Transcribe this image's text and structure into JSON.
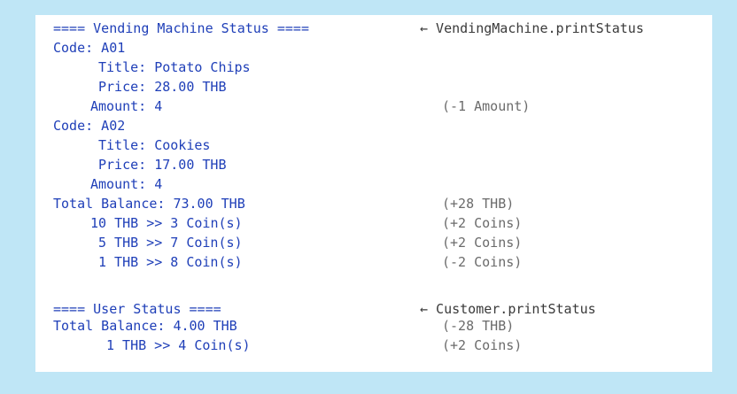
{
  "vending": {
    "header": "==== Vending Machine Status ====",
    "header_note": "← VendingMachine.printStatus",
    "items": [
      {
        "code": "Code: A01",
        "title": "Title: Potato Chips",
        "price": "Price: 28.00 THB",
        "amount": "Amount: 4",
        "amount_note": "(-1 Amount)"
      },
      {
        "code": "Code: A02",
        "title": "Title: Cookies",
        "price": "Price: 17.00 THB",
        "amount": "Amount: 4"
      }
    ],
    "balance": "Total Balance: 73.00 THB",
    "balance_note": "(+28 THB)",
    "coins": [
      {
        "text": "10 THB >> 3 Coin(s)",
        "note": "(+2 Coins)"
      },
      {
        "text": "5 THB >> 7 Coin(s)",
        "note": "(+2 Coins)"
      },
      {
        "text": "1 THB >> 8 Coin(s)",
        "note": "(-2 Coins)"
      }
    ]
  },
  "user": {
    "header": "==== User Status ====",
    "header_note": "← Customer.printStatus",
    "balance": "Total Balance: 4.00 THB",
    "balance_note": "(-28 THB)",
    "coins": [
      {
        "text": "1 THB >> 4 Coin(s)",
        "note": "(+2 Coins)"
      }
    ]
  },
  "colors": {
    "background": "#bfe6f6",
    "panel": "#ffffff",
    "output_text": "#1f3fb8",
    "note_text": "#6b6b6b"
  }
}
